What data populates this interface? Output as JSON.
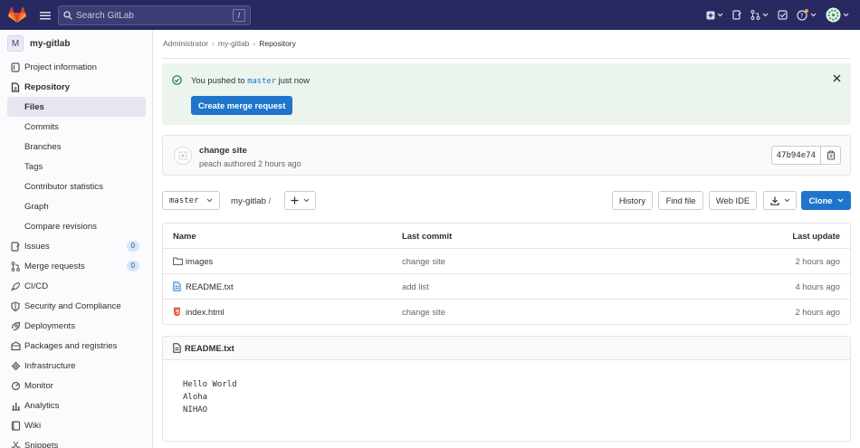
{
  "topbar": {
    "search_placeholder": "Search GitLab",
    "search_shortcut": "/",
    "brand_color": "#292961"
  },
  "sidebar": {
    "project_initial": "M",
    "project_name": "my-gitlab",
    "items": [
      {
        "label": "Project information",
        "icon": "info-icon"
      },
      {
        "label": "Repository",
        "icon": "document-icon"
      },
      {
        "label": "Issues",
        "icon": "issues-icon",
        "count": "0"
      },
      {
        "label": "Merge requests",
        "icon": "merge-request-icon",
        "count": "0"
      },
      {
        "label": "CI/CD",
        "icon": "rocket-icon"
      },
      {
        "label": "Security and Compliance",
        "icon": "shield-icon"
      },
      {
        "label": "Deployments",
        "icon": "deployments-icon"
      },
      {
        "label": "Packages and registries",
        "icon": "package-icon"
      },
      {
        "label": "Infrastructure",
        "icon": "cloud-icon"
      },
      {
        "label": "Monitor",
        "icon": "monitor-icon"
      },
      {
        "label": "Analytics",
        "icon": "chart-icon"
      },
      {
        "label": "Wiki",
        "icon": "book-icon"
      },
      {
        "label": "Snippets",
        "icon": "scissors-icon"
      }
    ],
    "repository_sub": [
      "Files",
      "Commits",
      "Branches",
      "Tags",
      "Contributor statistics",
      "Graph",
      "Compare revisions"
    ]
  },
  "breadcrumb": [
    "Administrator",
    "my-gitlab",
    "Repository"
  ],
  "alert": {
    "prefix": "You pushed to ",
    "branch": "master",
    "suffix": " just now",
    "button": "Create merge request"
  },
  "commit": {
    "title": "change site",
    "meta": "peach authored 2 hours ago",
    "sha": "47b94e74"
  },
  "toolbar": {
    "branch": "master",
    "path": "my-gitlab",
    "path_sep": "/",
    "history": "History",
    "find_file": "Find file",
    "web_ide": "Web IDE",
    "clone": "Clone"
  },
  "table": {
    "headers": [
      "Name",
      "Last commit",
      "Last update"
    ],
    "rows": [
      {
        "name": "images",
        "icon": "folder-icon",
        "commit": "change site",
        "updated": "2 hours ago"
      },
      {
        "name": "README.txt",
        "icon": "text-file-icon",
        "commit": "add list",
        "updated": "4 hours ago"
      },
      {
        "name": "index.html",
        "icon": "html-file-icon",
        "commit": "change site",
        "updated": "2 hours ago"
      }
    ]
  },
  "readme": {
    "title": "README.txt",
    "lines": [
      "Hello World",
      "Aloha",
      "NIHAO"
    ]
  }
}
